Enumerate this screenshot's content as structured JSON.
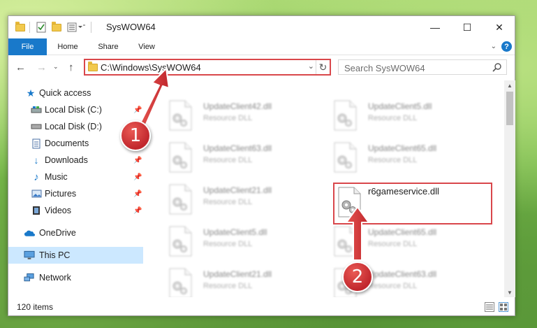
{
  "window": {
    "title": "SysWOW64",
    "controls": {
      "minimize": "—",
      "maximize": "☐",
      "close": "✕"
    }
  },
  "ribbon": {
    "tabs": [
      "File",
      "Home",
      "Share",
      "View"
    ],
    "help": "?"
  },
  "address": {
    "path": "C:\\Windows\\SysWOW64",
    "search_placeholder": "Search SysWOW64"
  },
  "sidebar": {
    "items": [
      {
        "label": "Quick access",
        "icon": "star-icon",
        "pinned": false
      },
      {
        "label": "Local Disk (C:)",
        "icon": "drive-icon",
        "pinned": true
      },
      {
        "label": "Local Disk (D:)",
        "icon": "drive-icon",
        "pinned": false
      },
      {
        "label": "Documents",
        "icon": "documents-icon",
        "pinned": true
      },
      {
        "label": "Downloads",
        "icon": "download-icon",
        "pinned": true
      },
      {
        "label": "Music",
        "icon": "music-icon",
        "pinned": true
      },
      {
        "label": "Pictures",
        "icon": "pictures-icon",
        "pinned": true
      },
      {
        "label": "Videos",
        "icon": "videos-icon",
        "pinned": true
      },
      {
        "label": "OneDrive",
        "icon": "cloud-icon",
        "pinned": false
      },
      {
        "label": "This PC",
        "icon": "computer-icon",
        "pinned": false,
        "selected": true
      },
      {
        "label": "Network",
        "icon": "network-icon",
        "pinned": false
      }
    ]
  },
  "files": {
    "col1": [
      {
        "name": "UpdateClient42.dll",
        "type": "Resource DLL"
      },
      {
        "name": "UpdateClient63.dll",
        "type": "Resource DLL"
      },
      {
        "name": "UpdateClient21.dll",
        "type": "Resource DLL"
      },
      {
        "name": "UpdateClient5.dll",
        "type": "Resource DLL"
      },
      {
        "name": "UpdateClient21.dll",
        "type": "Resource DLL"
      }
    ],
    "col2": [
      {
        "name": "UpdateClient5.dll",
        "type": "Resource DLL"
      },
      {
        "name": "UpdateClient65.dll",
        "type": "Resource DLL"
      },
      {
        "name": "r6gameservice.dll",
        "type": "",
        "highlighted": true
      },
      {
        "name": "UpdateClient65.dll",
        "type": "Resource DLL"
      },
      {
        "name": "UpdateClient63.dll",
        "type": "Resource DLL"
      }
    ]
  },
  "status": {
    "item_count": "120 items"
  },
  "annotations": {
    "step1": "1",
    "step2": "2"
  },
  "colors": {
    "accent": "#1979ca",
    "highlight": "#d9474b",
    "selected": "#cce8ff"
  }
}
